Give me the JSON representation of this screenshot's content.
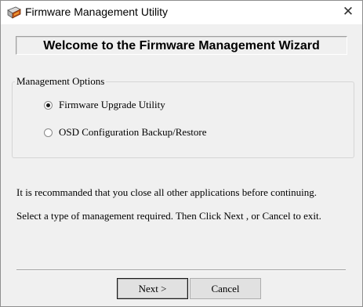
{
  "window": {
    "title": "Firmware Management Utility",
    "close_symbol": "✕"
  },
  "banner": {
    "heading": "Welcome to the Firmware Management Wizard"
  },
  "management_options": {
    "legend": "Management Options",
    "options": [
      {
        "label": "Firmware Upgrade Utility",
        "selected": true
      },
      {
        "label": "OSD Configuration Backup/Restore",
        "selected": false
      }
    ]
  },
  "instructions": {
    "line1": "It is recommanded that you close all other applications before continuing.",
    "line2": "Select a type of management required. Then Click Next , or Cancel to exit."
  },
  "buttons": {
    "next_label": "Next >",
    "cancel_label": "Cancel"
  },
  "colors": {
    "dialog_background": "#f0f0f0",
    "titlebar_background": "#ffffff"
  },
  "icons": {
    "app_icon": "firmware-flash-icon",
    "radio_selected": "radio-checked-icon",
    "radio_unselected": "radio-unchecked-icon"
  }
}
